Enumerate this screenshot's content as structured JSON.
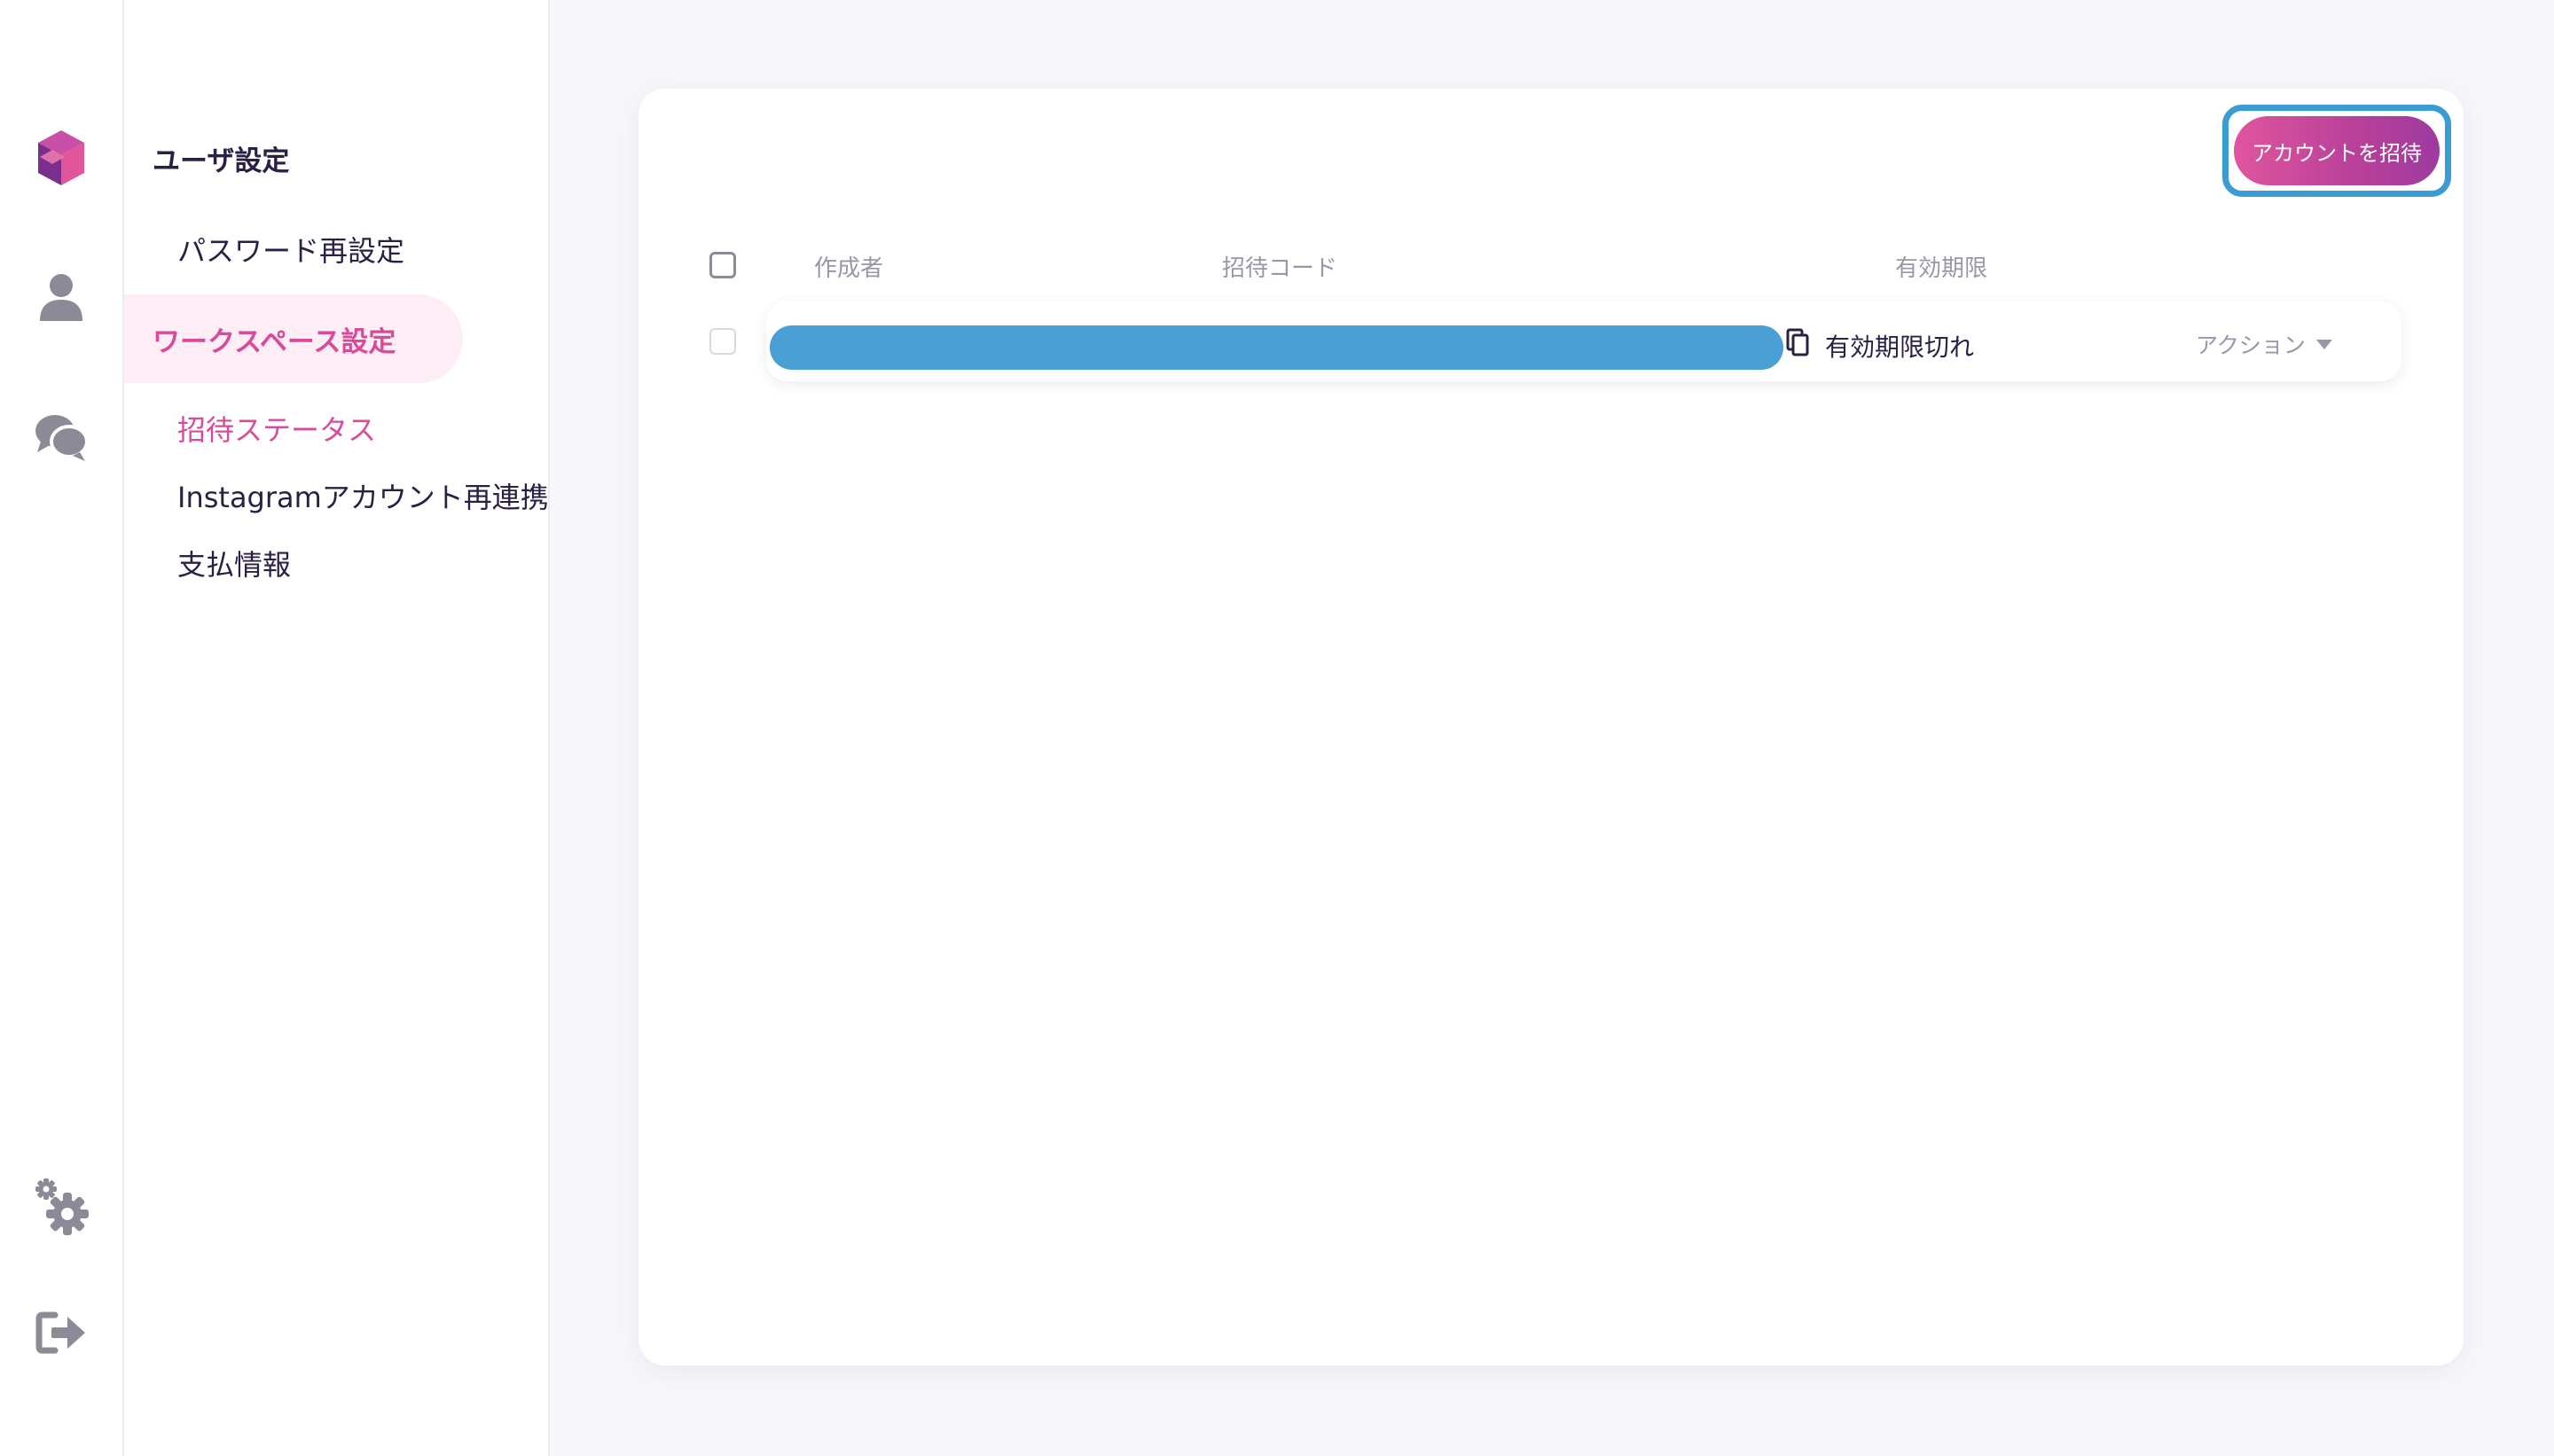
{
  "rail": {
    "icons": [
      "logo-icon",
      "user-icon",
      "chat-icon",
      "gear-icon",
      "logout-icon"
    ]
  },
  "menu": {
    "heading": "ユーザ設定",
    "password_reset": "パスワード再設定",
    "workspace_section": "ワークスペース設定",
    "invite_status": "招待ステータス",
    "instagram_relink": "Instagramアカウント再連携",
    "payment_info": "支払情報"
  },
  "main": {
    "invite_button": "アカウントを招待",
    "table": {
      "headers": {
        "creator": "作成者",
        "invite_code": "招待コード",
        "expiry": "有効期限"
      },
      "rows": [
        {
          "expiry_status": "有効期限切れ",
          "action_label": "アクション"
        }
      ]
    }
  },
  "colors": {
    "accent": "#d84a9a",
    "accent_bg": "#fdeef5",
    "focus_ring": "#3b9bd3",
    "redaction": "#4a9fd5",
    "icon_gray": "#8d8a98"
  }
}
